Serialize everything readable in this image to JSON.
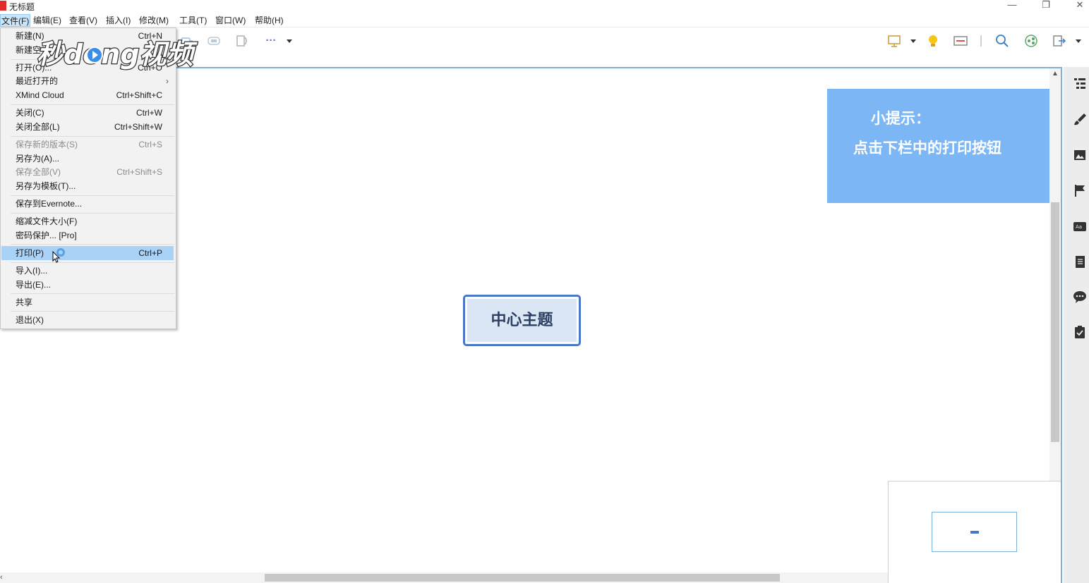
{
  "window": {
    "title": "无标题",
    "controls": {
      "minimize": "—",
      "maximize": "❐",
      "close": "✕"
    }
  },
  "menubar": {
    "items": [
      {
        "label": "文件(F)",
        "active": true
      },
      {
        "label": "编辑(E)"
      },
      {
        "label": "查看(V)"
      },
      {
        "label": "插入(I)"
      },
      {
        "label": "修改(M)"
      },
      {
        "label": "工具(T)"
      },
      {
        "label": "窗口(W)"
      },
      {
        "label": "帮助(H)"
      }
    ]
  },
  "toolbar": {
    "more_label": "···",
    "icons": [
      "insert-topic-icon",
      "boundary-icon",
      "summary-icon",
      "more-icon",
      "dropdown-icon",
      "presentation-icon",
      "idea-icon",
      "outline-icon",
      "zoom-icon",
      "share-icon",
      "export-icon"
    ]
  },
  "file_menu": {
    "items": [
      {
        "label": "新建(N)",
        "shortcut": "Ctrl+N"
      },
      {
        "label": "新建空",
        "shortcut": ""
      },
      {
        "label": "打开(O)...",
        "shortcut": "Ctrl+O"
      },
      {
        "label": "最近打开的",
        "shortcut": "",
        "submenu": "›"
      },
      {
        "label": "XMind Cloud",
        "shortcut": "Ctrl+Shift+C"
      },
      {
        "label": "关闭(C)",
        "shortcut": "Ctrl+W"
      },
      {
        "label": "关闭全部(L)",
        "shortcut": "Ctrl+Shift+W"
      },
      {
        "label": "保存新的版本(S)",
        "shortcut": "Ctrl+S",
        "disabled": true
      },
      {
        "label": "另存为(A)...",
        "shortcut": ""
      },
      {
        "label": "保存全部(V)",
        "shortcut": "Ctrl+Shift+S",
        "disabled": true
      },
      {
        "label": "另存为模板(T)...",
        "shortcut": ""
      },
      {
        "label": "保存到Evernote...",
        "shortcut": ""
      },
      {
        "label": "缩减文件大小(F)",
        "shortcut": ""
      },
      {
        "label": "密码保护... [Pro]",
        "shortcut": ""
      },
      {
        "label": "打印(P)",
        "shortcut": "Ctrl+P",
        "highlighted": true
      },
      {
        "label": "导入(I)...",
        "shortcut": ""
      },
      {
        "label": "导出(E)...",
        "shortcut": ""
      },
      {
        "label": "共享",
        "shortcut": ""
      },
      {
        "label": "退出(X)",
        "shortcut": ""
      }
    ]
  },
  "canvas": {
    "central_topic": "中心主题"
  },
  "tip": {
    "title": "小提示：",
    "body": "点击下栏中的打印按钮"
  },
  "watermark": {
    "text": "秒dong视频"
  },
  "sidebar": {
    "icons": [
      "outline-panel-icon",
      "format-brush-icon",
      "image-icon",
      "marker-flag-icon",
      "font-icon",
      "notes-icon",
      "comment-icon",
      "task-icon"
    ]
  },
  "colors": {
    "accent": "#7fb1d8",
    "menu_highlight": "#aad2f7",
    "tip_background": "#7db6f4",
    "topic_border": "#4a78c6",
    "topic_fill": "#dce7f5"
  }
}
